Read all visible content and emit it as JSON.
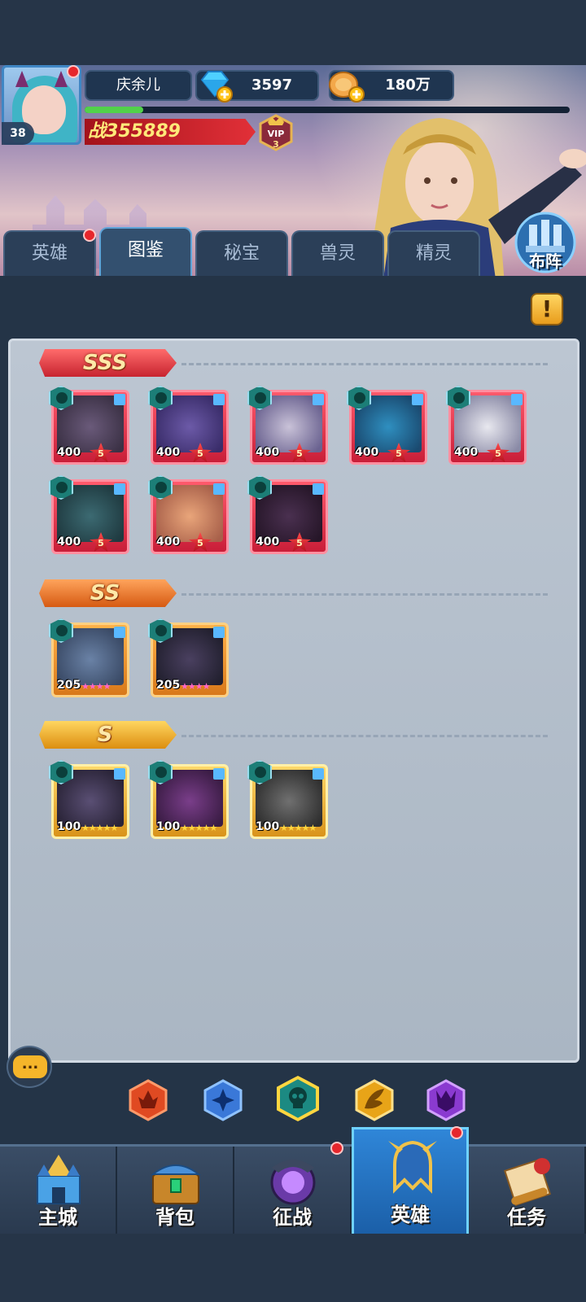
{
  "player": {
    "name": "庆余儿",
    "level": "38",
    "power_prefix": "战",
    "power": "355889",
    "vip_label": "VIP",
    "vip_level": "3",
    "exp_progress": 0.12
  },
  "resources": {
    "diamonds": "3597",
    "gold": "180万"
  },
  "tabs": [
    {
      "label": "英雄",
      "active": false,
      "badge": true
    },
    {
      "label": "图鉴",
      "active": true,
      "badge": false
    },
    {
      "label": "秘宝",
      "active": false,
      "badge": false
    },
    {
      "label": "兽灵",
      "active": false,
      "badge": false
    },
    {
      "label": "精灵",
      "active": false,
      "badge": false
    }
  ],
  "formation_button": "布阵",
  "info_button": "!",
  "tiers": [
    {
      "label": "SSS",
      "heroes": [
        {
          "level": "400",
          "rank": "5"
        },
        {
          "level": "400",
          "rank": "5"
        },
        {
          "level": "400",
          "rank": "5"
        },
        {
          "level": "400",
          "rank": "5"
        },
        {
          "level": "400",
          "rank": "5"
        },
        {
          "level": "400",
          "rank": "5"
        },
        {
          "level": "400",
          "rank": "5"
        },
        {
          "level": "400",
          "rank": "5"
        }
      ]
    },
    {
      "label": "SS",
      "heroes": [
        {
          "level": "205",
          "stars": 4
        },
        {
          "level": "205",
          "stars": 4
        }
      ]
    },
    {
      "label": "S",
      "heroes": [
        {
          "level": "100",
          "stars": 5
        },
        {
          "level": "100",
          "stars": 5
        },
        {
          "level": "100",
          "stars": 5
        }
      ]
    }
  ],
  "chat_icon": "...",
  "faction_filters": [
    {
      "name": "fire-faction-icon",
      "color": "#e04a22",
      "selected": false
    },
    {
      "name": "holy-faction-icon",
      "color": "#3a78d8",
      "selected": false
    },
    {
      "name": "undead-faction-icon",
      "color": "#1c8a82",
      "selected": true
    },
    {
      "name": "nature-faction-icon",
      "color": "#e8a418",
      "selected": false
    },
    {
      "name": "demon-faction-icon",
      "color": "#8a3ad0",
      "selected": false
    }
  ],
  "bottom_nav": [
    {
      "label": "主城",
      "active": false,
      "badge": false
    },
    {
      "label": "背包",
      "active": false,
      "badge": false
    },
    {
      "label": "征战",
      "active": false,
      "badge": true
    },
    {
      "label": "英雄",
      "active": true,
      "badge": true
    },
    {
      "label": "任务",
      "active": false,
      "badge": false
    }
  ]
}
